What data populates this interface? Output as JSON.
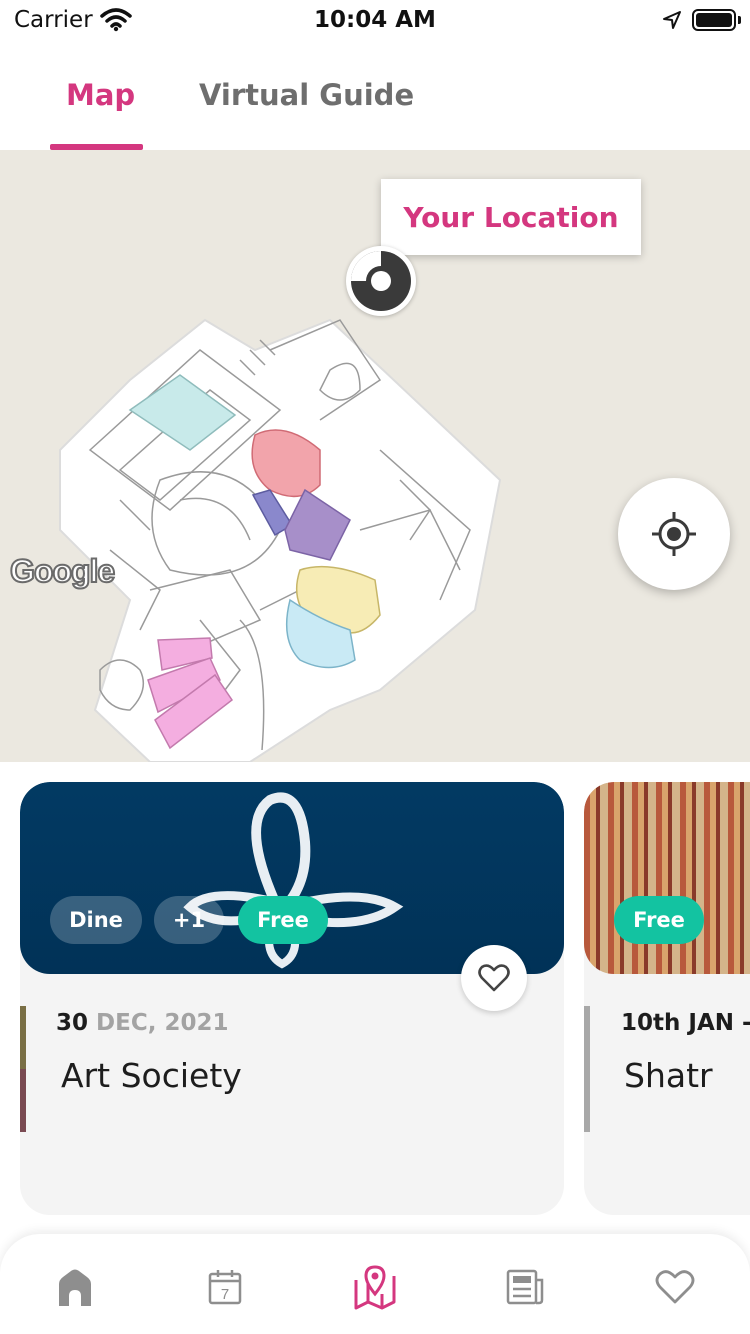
{
  "status_bar": {
    "carrier": "Carrier",
    "time": "10:04 AM"
  },
  "tabs": [
    {
      "label": "Map",
      "active": true
    },
    {
      "label": "Virtual Guide",
      "active": false
    }
  ],
  "map": {
    "location_tooltip": "Your Location",
    "provider_logo": "Google",
    "recenter_icon": "crosshair-icon"
  },
  "cards": [
    {
      "badges": [
        "Dine",
        "+1",
        "Free"
      ],
      "date_day": "30",
      "date_rest": " DEC, 2021",
      "title": "Art Society",
      "favorite_icon": "heart-outline-icon"
    },
    {
      "badges": [
        "Free"
      ],
      "date_day": "10th JAN -",
      "date_rest": "",
      "title": "Shatr"
    }
  ],
  "bottom_nav": [
    {
      "icon": "home-icon",
      "active": false
    },
    {
      "icon": "calendar-icon",
      "label": "7",
      "active": false
    },
    {
      "icon": "map-icon",
      "active": true
    },
    {
      "icon": "news-icon",
      "active": false
    },
    {
      "icon": "heart-icon",
      "active": false
    }
  ],
  "colors": {
    "accent": "#d4377f",
    "free_badge": "#13c3a1",
    "map_bg": "#ebe8e0",
    "card_navy": "#023a63"
  }
}
